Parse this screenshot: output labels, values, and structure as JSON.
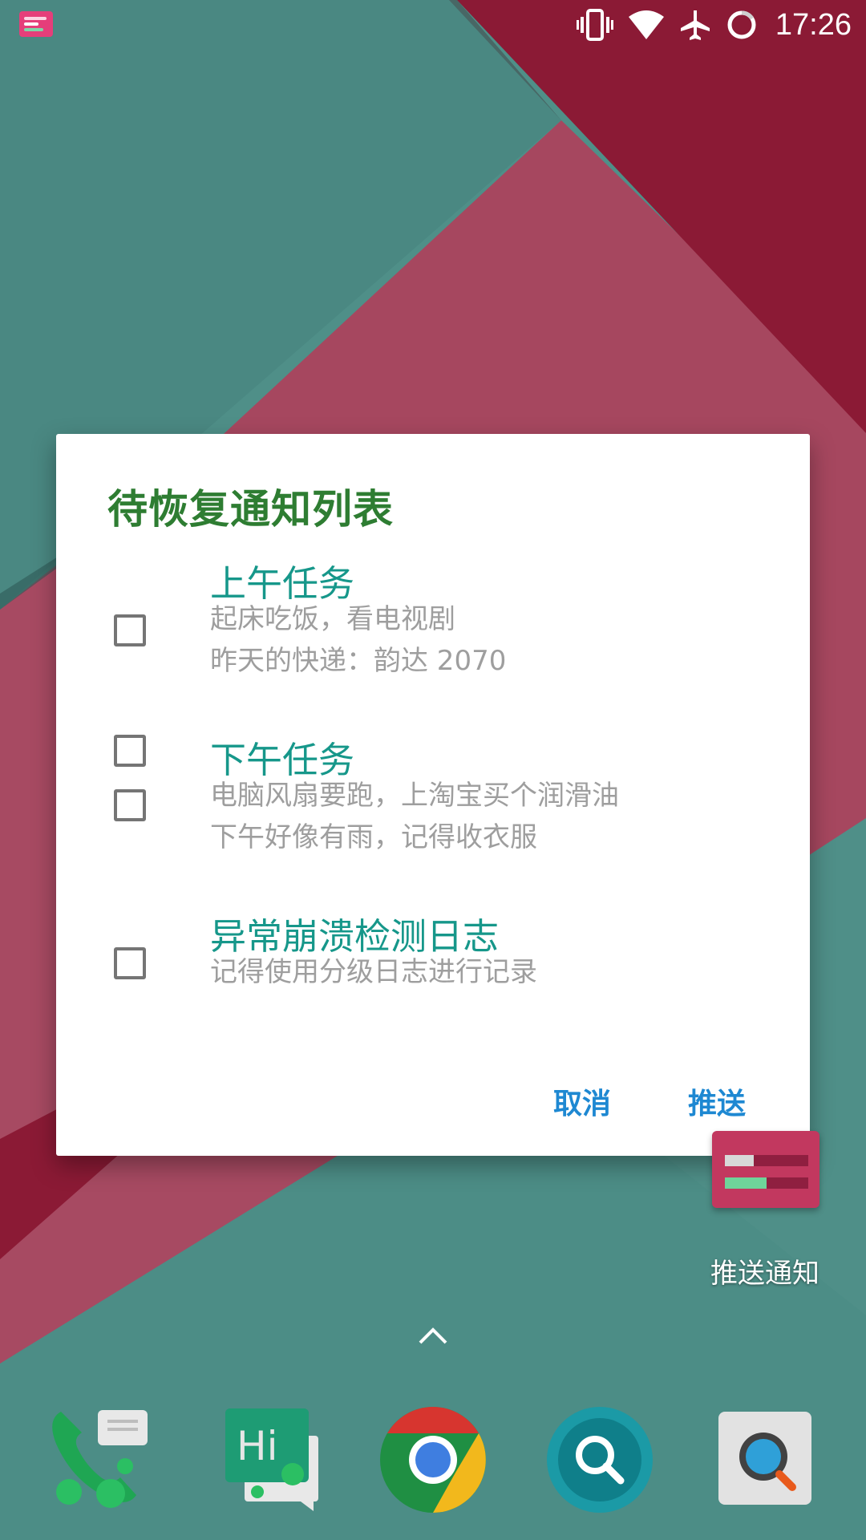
{
  "status_bar": {
    "time": "17:26",
    "icons": [
      "notification-app-icon",
      "vibrate-icon",
      "wifi-icon",
      "airplane-icon",
      "battery-ring-icon"
    ]
  },
  "dialog": {
    "title": "待恢复通知列表",
    "items": [
      {
        "title": "上午任务",
        "lines": [
          "起床吃饭，看电视剧",
          "昨天的快递：韵达 2070"
        ],
        "checked": false
      },
      {
        "title": "下午任务",
        "lines": [
          "电脑风扇要跑，上淘宝买个润滑油",
          "下午好像有雨，记得收衣服"
        ],
        "checked": false
      },
      {
        "title": "异常崩溃检测日志",
        "lines": [
          "记得使用分级日志进行记录"
        ],
        "checked": false
      }
    ],
    "cancel_label": "取消",
    "confirm_label": "推送"
  },
  "desktop": {
    "widget_label": "推送通知",
    "dock": [
      "phone-messages-icon",
      "hi-chat-icon",
      "chrome-icon",
      "search-app-icon",
      "magnifier-app-icon"
    ]
  },
  "colors": {
    "title": "#2e7d32",
    "item_title": "#16978a",
    "button": "#1e88d2",
    "teal_bg": "#4f8f88",
    "crimson": "#8b1a35",
    "rose": "#a6475f"
  }
}
